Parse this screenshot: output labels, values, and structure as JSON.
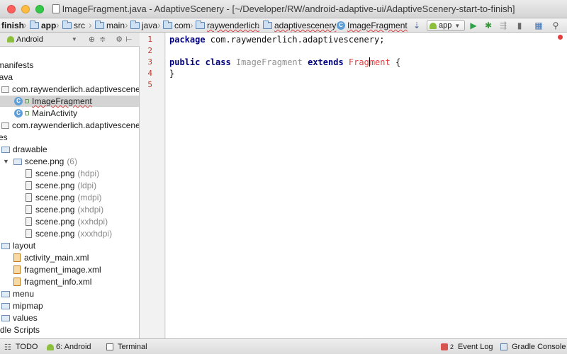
{
  "window": {
    "title": "ImageFragment.java - AdaptiveScenery - [~/Developer/RW/android-adaptive-ui/AdaptiveScenery-start-to-finish]"
  },
  "breadcrumb": {
    "items": [
      "finish",
      "app",
      "src",
      "main",
      "java",
      "com",
      "raywenderlich",
      "adaptivescenery",
      "ImageFragment"
    ],
    "run_config": "app"
  },
  "project_panel": {
    "view_mode": "Android",
    "tree": [
      {
        "label": "manifests",
        "type": "folder"
      },
      {
        "label": "java",
        "type": "folder"
      },
      {
        "label": "com.raywenderlich.adaptivescenery",
        "type": "package"
      },
      {
        "label": "ImageFragment",
        "type": "class",
        "selected": true
      },
      {
        "label": "MainActivity",
        "type": "class"
      },
      {
        "label": "com.raywenderlich.adaptivescenery",
        "type": "package"
      },
      {
        "label": "res",
        "type": "folder"
      },
      {
        "label": "drawable",
        "type": "folder"
      },
      {
        "label": "scene.png",
        "type": "group",
        "note": "(6)"
      },
      {
        "label": "scene.png",
        "type": "png",
        "note": "(hdpi)"
      },
      {
        "label": "scene.png",
        "type": "png",
        "note": "(ldpi)"
      },
      {
        "label": "scene.png",
        "type": "png",
        "note": "(mdpi)"
      },
      {
        "label": "scene.png",
        "type": "png",
        "note": "(xhdpi)"
      },
      {
        "label": "scene.png",
        "type": "png",
        "note": "(xxhdpi)"
      },
      {
        "label": "scene.png",
        "type": "png",
        "note": "(xxxhdpi)"
      },
      {
        "label": "layout",
        "type": "folder"
      },
      {
        "label": "activity_main.xml",
        "type": "xml"
      },
      {
        "label": "fragment_image.xml",
        "type": "xml"
      },
      {
        "label": "fragment_info.xml",
        "type": "xml"
      },
      {
        "label": "menu",
        "type": "folder"
      },
      {
        "label": "mipmap",
        "type": "folder"
      },
      {
        "label": "values",
        "type": "folder"
      },
      {
        "label": "Gradle Scripts",
        "type": "gradle"
      }
    ]
  },
  "editor": {
    "line_numbers": [
      "1",
      "2",
      "3",
      "4",
      "5"
    ],
    "code": {
      "line1_kw": "package",
      "line1_rest": " com.raywenderlich.adaptivescenery;",
      "line3_kw1": "public",
      "line3_kw2": "class",
      "line3_class": "ImageFragment",
      "line3_kw3": "extends",
      "line3_err_a": "Frag",
      "line3_err_b": "ment",
      "line3_brace": " {",
      "line4": "}"
    }
  },
  "bottom_bar": {
    "todo": "TODO",
    "android": "6: Android",
    "terminal": "Terminal",
    "event_log_count": "2",
    "event_log": "Event Log",
    "gradle_console": "Gradle Console"
  }
}
